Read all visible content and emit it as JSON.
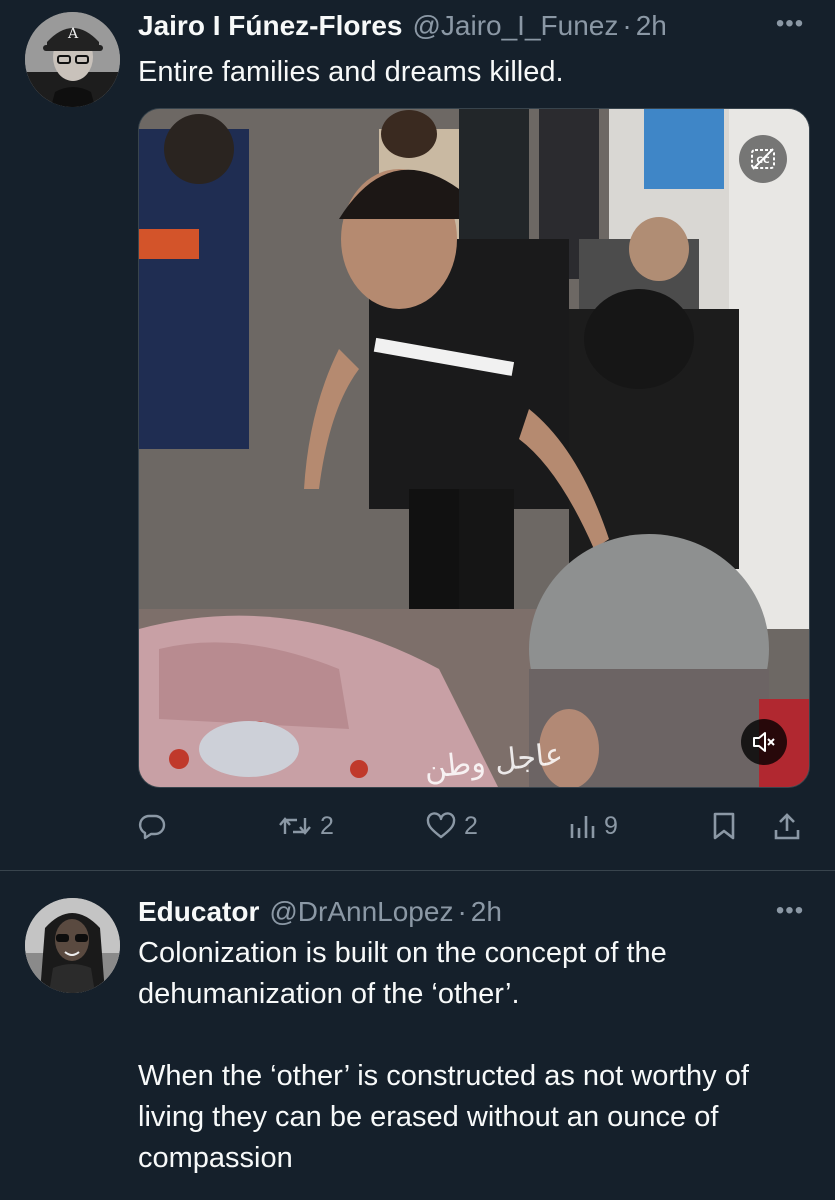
{
  "tweets": [
    {
      "name": "Jairo I Fúnez-Flores",
      "handle": "@Jairo_I_Funez",
      "dot": "·",
      "time": "2h",
      "text": "Entire families and dreams killed.",
      "avatar_icon": "profile-photo",
      "media": {
        "watermark": "عاجل وطن",
        "cc_icon": "captions-icon",
        "mute_icon": "volume-muted-icon"
      },
      "actions": {
        "replies": "",
        "retweets": "2",
        "likes": "2",
        "views": "9"
      }
    },
    {
      "name": "Educator",
      "handle": "@DrAnnLopez",
      "dot": "·",
      "time": "2h",
      "text": "Colonization is built on the concept of the dehumanization of the ‘other’.\n\nWhen the ‘other’ is constructed as not worthy of living they can be erased without an ounce of compassion",
      "avatar_icon": "profile-photo"
    }
  ],
  "more_icon": "•••",
  "colors": {
    "background": "#15202b",
    "secondary_text": "#8b98a5",
    "divider": "#38444d"
  }
}
